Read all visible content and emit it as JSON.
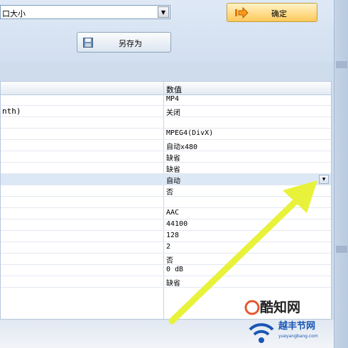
{
  "top": {
    "size_dropdown_value": "口大小",
    "ok_label": "确定",
    "save_as_label": "另存为"
  },
  "grid": {
    "value_header": "数值",
    "rows": [
      {
        "name": "",
        "value": "MP4"
      },
      {
        "name": "nth)",
        "value": "关闭"
      },
      {
        "name": "",
        "value": ""
      },
      {
        "name": "",
        "value": "MPEG4(DivX)"
      },
      {
        "name": "",
        "value": "自动x480"
      },
      {
        "name": "",
        "value": "缺省"
      },
      {
        "name": "",
        "value": "缺省"
      },
      {
        "name": "",
        "value": "自动"
      },
      {
        "name": "",
        "value": "否"
      },
      {
        "name": "",
        "value": ""
      },
      {
        "name": "",
        "value": "AAC"
      },
      {
        "name": "",
        "value": "44100"
      },
      {
        "name": "",
        "value": "128"
      },
      {
        "name": "",
        "value": "2"
      },
      {
        "name": "",
        "value": "否"
      },
      {
        "name": "",
        "value": "0 dB"
      },
      {
        "name": "",
        "value": "缺省"
      }
    ]
  },
  "watermark": {
    "title": "酷知网",
    "subtitle": "越丰节网",
    "url": "yueyangbang.com"
  },
  "colors": {
    "highlight_arrow": "#e8f23a",
    "ok_button": "#ffc95a",
    "selected_row": "#dde8f6"
  }
}
